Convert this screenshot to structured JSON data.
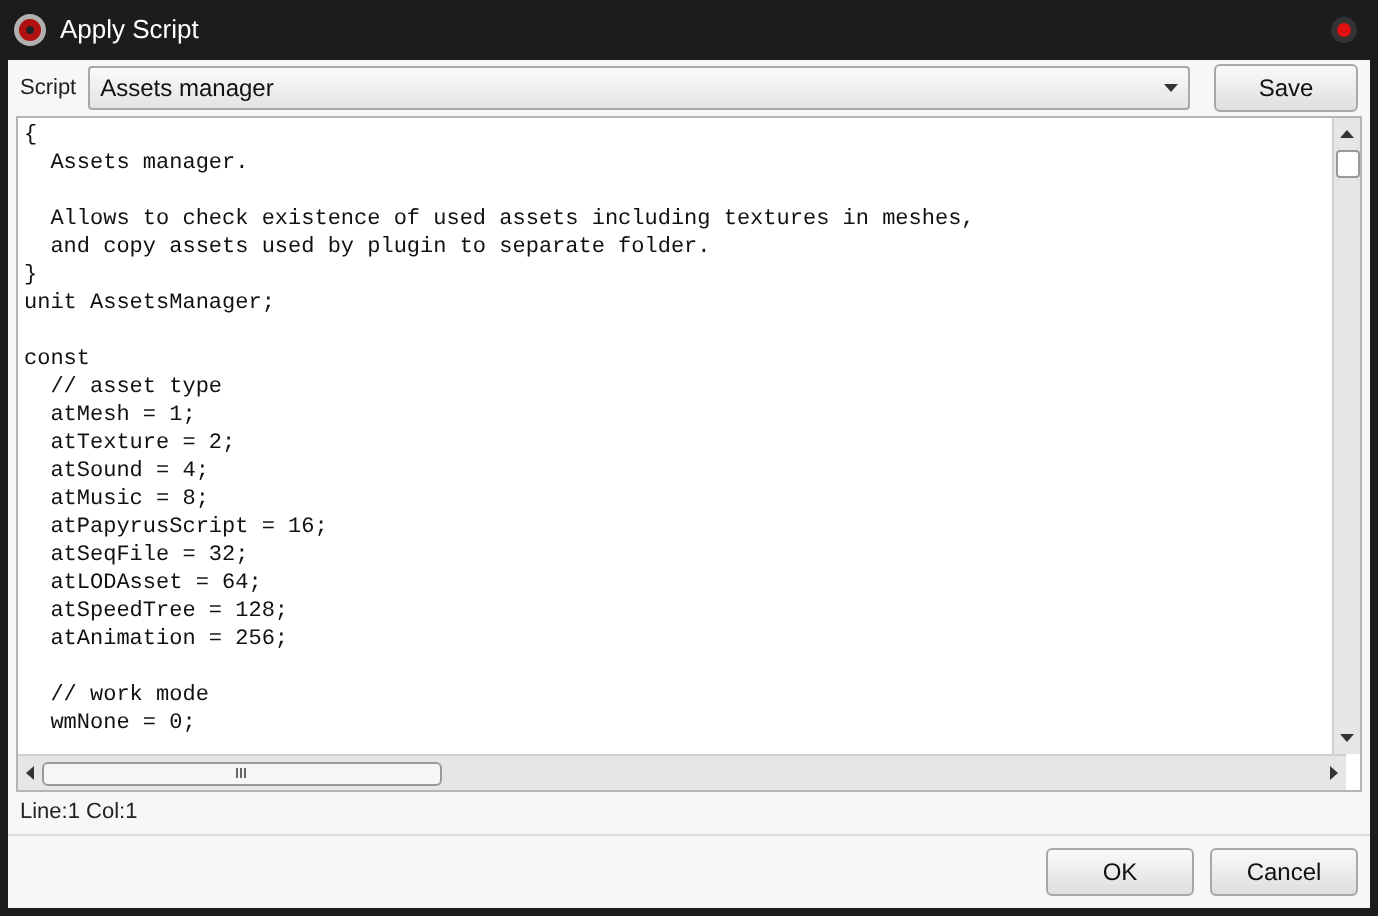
{
  "window": {
    "title": "Apply Script"
  },
  "toolbar": {
    "label": "Script",
    "script_select": {
      "value": "Assets manager"
    },
    "save_button": "Save"
  },
  "editor": {
    "code": "{\n  Assets manager.\n\n  Allows to check existence of used assets including textures in meshes,\n  and copy assets used by plugin to separate folder.\n}\nunit AssetsManager;\n\nconst\n  // asset type\n  atMesh = 1;\n  atTexture = 2;\n  atSound = 4;\n  atMusic = 8;\n  atPapyrusScript = 16;\n  atSeqFile = 32;\n  atLODAsset = 64;\n  atSpeedTree = 128;\n  atAnimation = 256;\n\n  // work mode\n  wmNone = 0;"
  },
  "status_bar": "Line:1 Col:1",
  "buttons": [
    "OK",
    "Cancel"
  ]
}
